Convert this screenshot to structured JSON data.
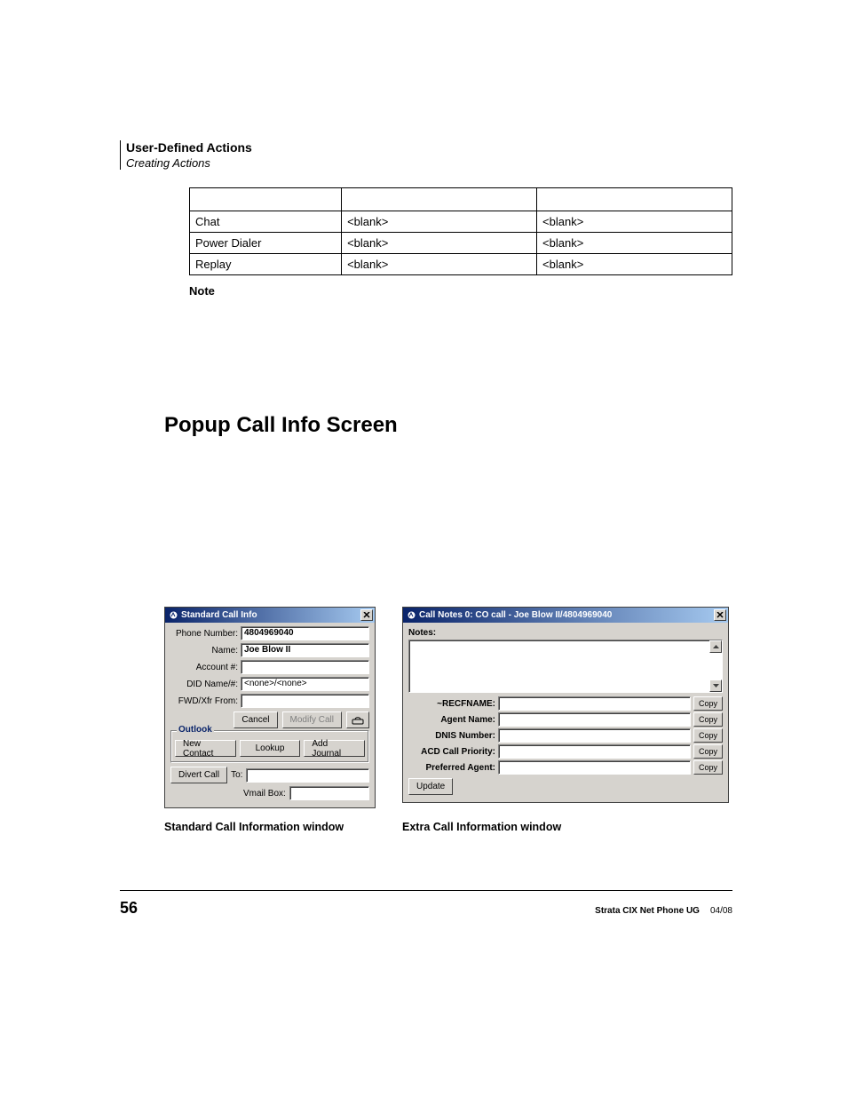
{
  "header": {
    "section": "User-Defined Actions",
    "subsection": "Creating Actions"
  },
  "table": {
    "rows": [
      {
        "c1": "Chat",
        "c2": "<blank>",
        "c3": "<blank>"
      },
      {
        "c1": "Power Dialer",
        "c2": "<blank>",
        "c3": "<blank>"
      },
      {
        "c1": "Replay",
        "c2": "<blank>",
        "c3": "<blank>"
      }
    ]
  },
  "note_label": "Note",
  "heading": "Popup Call Info Screen",
  "win1": {
    "title": "Standard Call Info",
    "labels": {
      "phone": "Phone Number:",
      "name": "Name:",
      "account": "Account #:",
      "did": "DID Name/#:",
      "fwd": "FWD/Xfr From:"
    },
    "values": {
      "phone": "4804969040",
      "name": "Joe Blow II",
      "account": "",
      "did": "<none>/<none>",
      "fwd": ""
    },
    "buttons": {
      "cancel": "Cancel",
      "modify": "Modify Call",
      "new_contact": "New Contact",
      "lookup": "Lookup",
      "add_journal": "Add Journal",
      "divert": "Divert Call",
      "update": "Update"
    },
    "outlook_legend": "Outlook",
    "to_label": "To:",
    "vmail_label": "Vmail Box:",
    "to_value": "",
    "vmail_value": ""
  },
  "win2": {
    "title": "Call Notes 0: CO call - Joe Blow II/4804969040",
    "notes_label": "Notes:",
    "rows": [
      {
        "label": "~RECFNAME:",
        "value": ""
      },
      {
        "label": "Agent Name:",
        "value": ""
      },
      {
        "label": "DNIS Number:",
        "value": ""
      },
      {
        "label": "ACD Call Priority:",
        "value": ""
      },
      {
        "label": "Preferred Agent:",
        "value": ""
      }
    ],
    "copy_label": "Copy",
    "update_label": "Update"
  },
  "captions": {
    "c1": "Standard Call Information window",
    "c2": "Extra Call Information window"
  },
  "footer": {
    "page": "56",
    "doc": "Strata CIX Net Phone UG",
    "date": "04/08"
  }
}
